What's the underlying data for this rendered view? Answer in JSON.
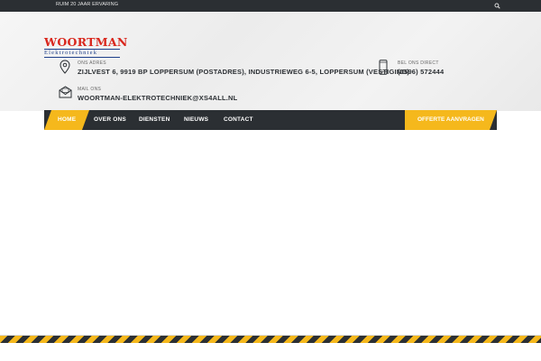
{
  "topbar": {
    "tagline": "RUIM 20 JAAR ERVARING",
    "search_icon": "search-icon"
  },
  "logo": {
    "main": "WOORTMAN",
    "sub": "Elektrotechniek"
  },
  "address": {
    "label": "ONS ADRES",
    "value": "ZIJLVEST 6, 9919 BP LOPPERSUM (POSTADRES), INDUSTRIEWEG 6-5, LOPPERSUM (VESTIGING)",
    "icon": "map-pin-icon"
  },
  "phone": {
    "label": "BEL ONS DIRECT",
    "value": "(0596) 572444",
    "icon": "phone-icon"
  },
  "mail": {
    "label": "MAIL ONS",
    "value": "WOORTMAN-ELEKTROTECHNIEK@XS4ALL.NL",
    "icon": "mail-icon"
  },
  "nav": {
    "items": [
      {
        "label": "HOME"
      },
      {
        "label": "OVER ONS"
      },
      {
        "label": "DIENSTEN"
      },
      {
        "label": "NIEUWS"
      },
      {
        "label": "CONTACT"
      }
    ],
    "cta": "OFFERTE AANVRAGEN"
  },
  "colors": {
    "accent": "#f5b81c",
    "dark": "#2b2f33",
    "brand_red": "#d9261c",
    "brand_blue": "#1d3f8a"
  }
}
